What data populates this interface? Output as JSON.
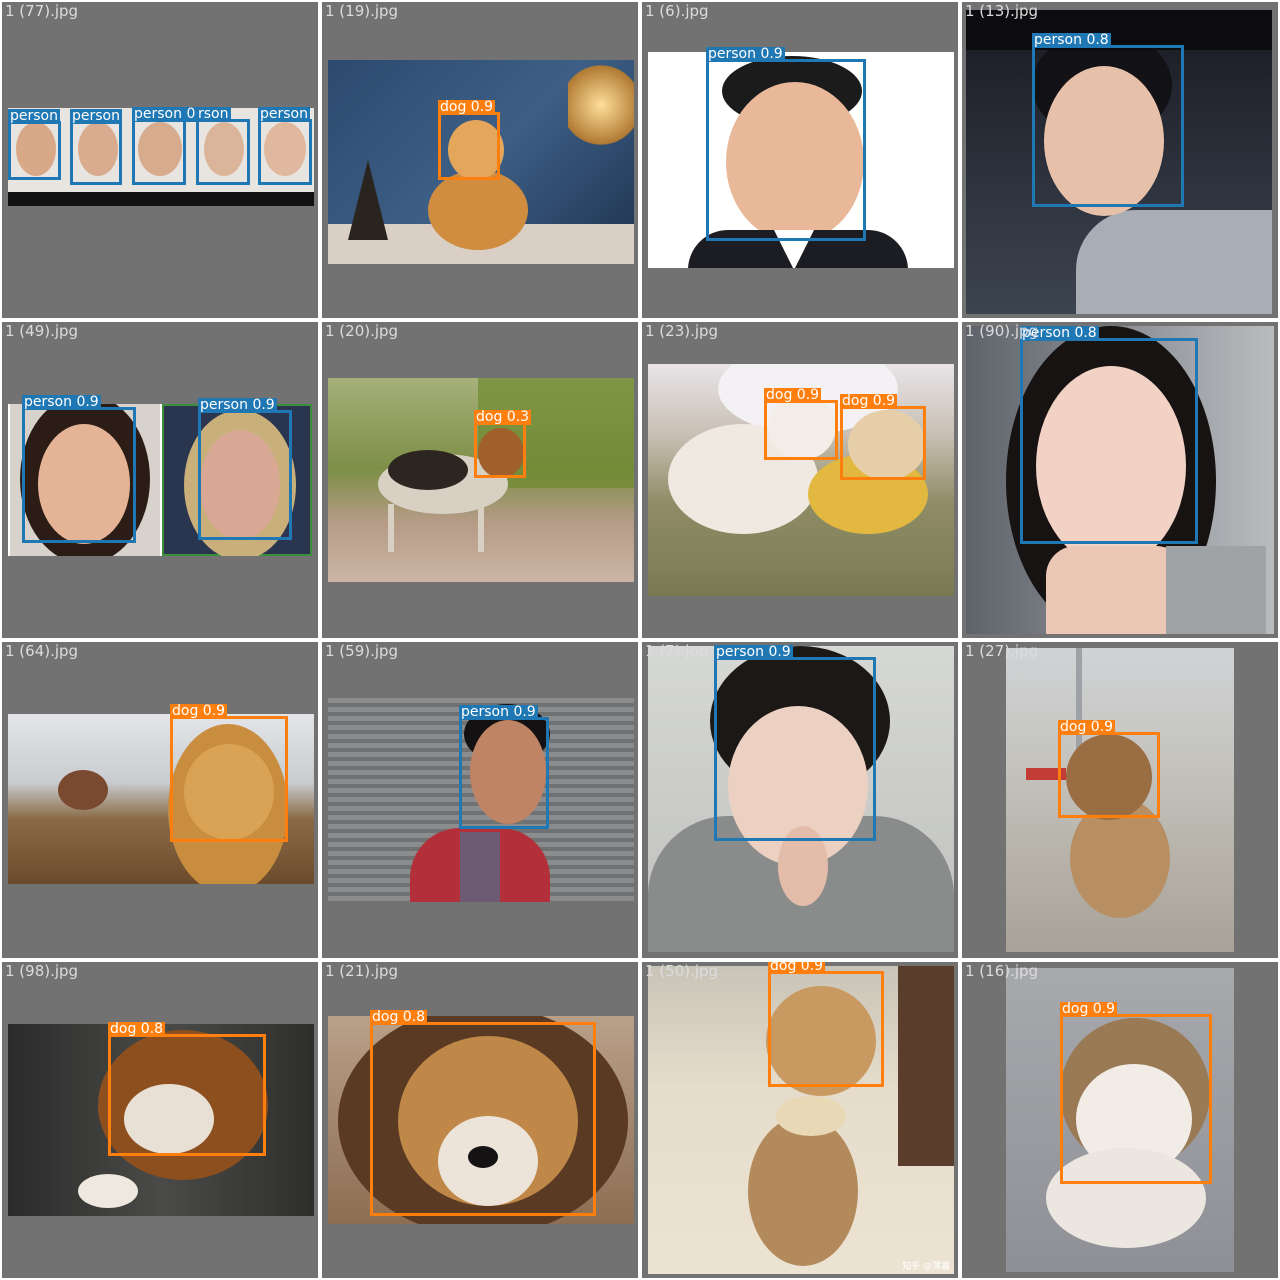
{
  "colors": {
    "person": "#1f77b4",
    "dog": "#ff7f0e",
    "tile_bg": "#727272",
    "filename_text": "#dcdcdc"
  },
  "images": [
    {
      "file": "1 (77).jpg",
      "detections": [
        {
          "cls": "person",
          "label": "person"
        },
        {
          "cls": "person",
          "label": "person"
        },
        {
          "cls": "person",
          "label": "person 0.9"
        },
        {
          "cls": "person",
          "label": "rson"
        },
        {
          "cls": "person",
          "label": "person"
        }
      ]
    },
    {
      "file": "1 (19).jpg",
      "detections": [
        {
          "cls": "dog",
          "label": "dog 0.9"
        }
      ]
    },
    {
      "file": "1 (6).jpg",
      "detections": [
        {
          "cls": "person",
          "label": "person 0.9"
        }
      ]
    },
    {
      "file": "1 (13).jpg",
      "detections": [
        {
          "cls": "person",
          "label": "person 0.8"
        }
      ]
    },
    {
      "file": "1 (49).jpg",
      "detections": [
        {
          "cls": "person",
          "label": "person 0.9"
        },
        {
          "cls": "person",
          "label": "person 0.9"
        }
      ]
    },
    {
      "file": "1 (20).jpg",
      "detections": [
        {
          "cls": "dog",
          "label": "dog 0.3"
        }
      ]
    },
    {
      "file": "1 (23).jpg",
      "detections": [
        {
          "cls": "dog",
          "label": "dog 0.9"
        },
        {
          "cls": "dog",
          "label": "dog 0.9"
        }
      ]
    },
    {
      "file": "1 (90).jpg",
      "detections": [
        {
          "cls": "person",
          "label": "person 0.8"
        }
      ]
    },
    {
      "file": "1 (64).jpg",
      "detections": [
        {
          "cls": "dog",
          "label": "dog 0.9"
        }
      ]
    },
    {
      "file": "1 (59).jpg",
      "detections": [
        {
          "cls": "person",
          "label": "person 0.9"
        }
      ]
    },
    {
      "file": "1 (7).jpg",
      "detections": [
        {
          "cls": "person",
          "label": "person 0.9"
        }
      ]
    },
    {
      "file": "1 (27).jpg",
      "detections": [
        {
          "cls": "dog",
          "label": "dog 0.9"
        }
      ]
    },
    {
      "file": "1 (98).jpg",
      "detections": [
        {
          "cls": "dog",
          "label": "dog 0.8"
        }
      ]
    },
    {
      "file": "1 (21).jpg",
      "detections": [
        {
          "cls": "dog",
          "label": "dog 0.8"
        }
      ]
    },
    {
      "file": "1 (50).jpg",
      "detections": [
        {
          "cls": "dog",
          "label": "dog 0.9"
        }
      ]
    },
    {
      "file": "1 (16).jpg",
      "detections": [
        {
          "cls": "dog",
          "label": "dog 0.9"
        }
      ]
    }
  ],
  "watermark": "知乎 @薄暮"
}
